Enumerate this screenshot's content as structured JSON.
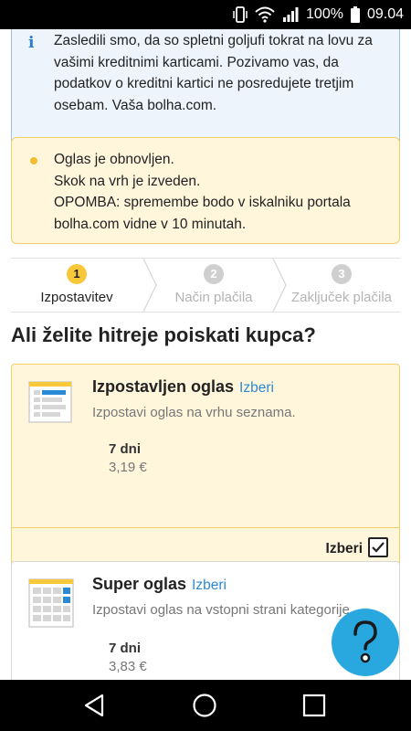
{
  "status_bar": {
    "battery": "100%",
    "time": "09.04",
    "icons": [
      "vibrate-icon",
      "wifi-icon",
      "signal-icon",
      "battery-icon"
    ]
  },
  "info_notice": {
    "icon": "info-icon",
    "icon_glyph": "i",
    "text": "Zasledili smo, da so spletni goljufi tokrat na lovu za vašimi kreditnimi karticami. Pozivamo vas, da podatkov o kreditni kartici ne posredujete tretjim osebam. Vaša bolha.com."
  },
  "status_notice": {
    "icon": "bullet-dot-icon",
    "lines": [
      "Oglas je obnovljen.",
      "Skok na vrh je izveden.",
      "OPOMBA: spremembe bodo v iskalniku portala",
      "bolha.com vidne v 10 minutah."
    ]
  },
  "stepper": {
    "steps": [
      {
        "number": "1",
        "label": "Izpostavitev",
        "state": "active"
      },
      {
        "number": "2",
        "label": "Način plačila",
        "state": "inactive"
      },
      {
        "number": "3",
        "label": "Zaključek plačila",
        "state": "inactive"
      }
    ]
  },
  "heading": "Ali želite hitreje poiskati kupca?",
  "offers": [
    {
      "title": "Izpostavljen oglas",
      "select_link": "Izberi",
      "description": "Izpostavi oglas na vrhu seznama.",
      "duration": "7 dni",
      "price": "3,19 €",
      "footer_label": "Izberi",
      "checked": true,
      "icon": "list-highlight-icon"
    },
    {
      "title": "Super oglas",
      "select_link": "Izberi",
      "description": "Izpostavi oglas na vstopni strani kategorije",
      "duration": "7 dni",
      "price": "3,83 €",
      "icon": "grid-highlight-icon"
    }
  ],
  "help_button": {
    "icon": "help-question-icon"
  },
  "nav_bar": {
    "icons": [
      "back-icon",
      "home-icon",
      "recents-icon"
    ]
  },
  "colors": {
    "info_bg": "#eef4fb",
    "info_border": "#9fc0e6",
    "notice_bg": "#fff6dc",
    "notice_border": "#f1cf6a",
    "accent_yellow": "#f6c83a",
    "link_blue": "#2b8ad6",
    "fab_blue": "#29a8e0"
  }
}
